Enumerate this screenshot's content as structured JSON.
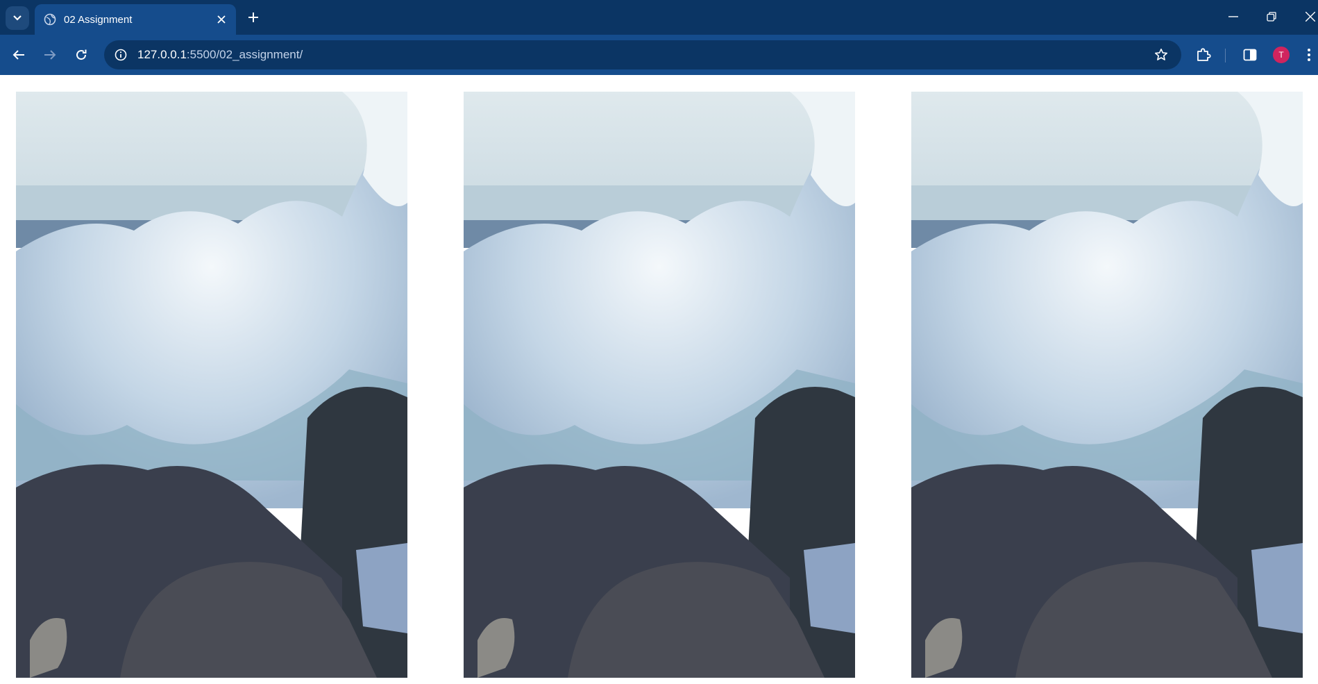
{
  "browser": {
    "tab": {
      "title": "02 Assignment"
    },
    "address_bar": {
      "host": "127.0.0.1",
      "path": ":5500/02_assignment/"
    },
    "profile_initial": "T"
  },
  "page": {
    "images": [
      {
        "subject": "ocean wave crashing on rocks"
      },
      {
        "subject": "ocean wave crashing on rocks"
      },
      {
        "subject": "ocean wave crashing on rocks"
      }
    ]
  },
  "colors": {
    "chrome_dark": "#0b3564",
    "chrome_toolbar": "#154c8c",
    "avatar": "#d0245e",
    "page_background": "#ffffff"
  }
}
